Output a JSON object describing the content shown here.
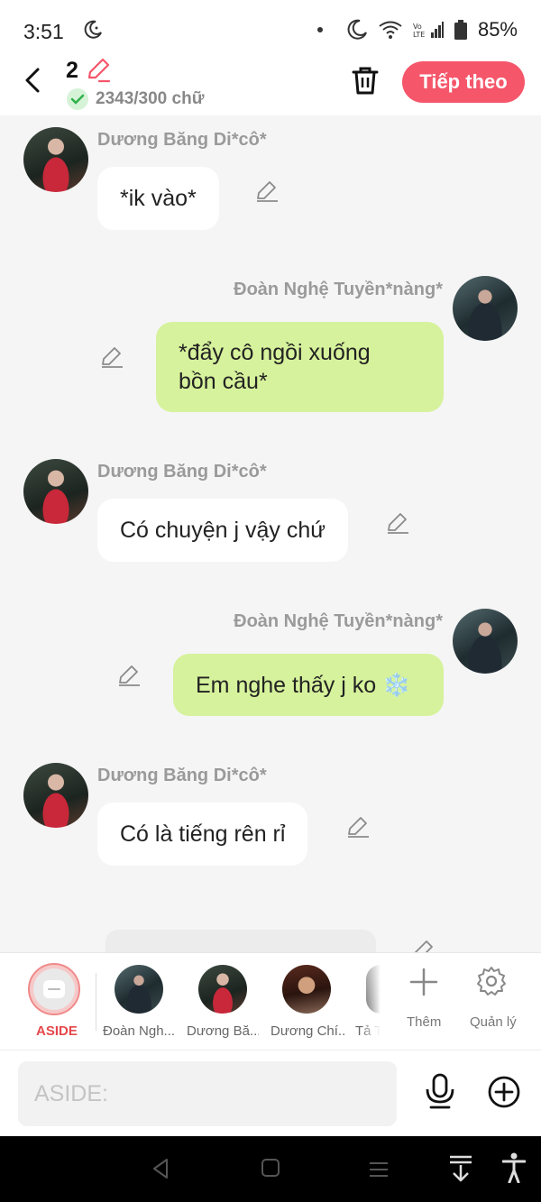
{
  "status_bar": {
    "time": "3:51",
    "battery": "85%"
  },
  "header": {
    "count": "2",
    "word_count": "2343/300 chữ",
    "next_label": "Tiếp theo"
  },
  "messages": [
    {
      "side": "in",
      "name": "Dương Băng Di*cô*",
      "text": "*ik vào*"
    },
    {
      "side": "out",
      "name": "Đoàn Nghệ Tuyền*nàng*",
      "line1": "*đẩy cô ngồi xuống",
      "line2": "bồn cầu*"
    },
    {
      "side": "in",
      "name": "Dương Băng Di*cô*",
      "text": "Có chuyện j vậy chứ"
    },
    {
      "side": "out",
      "name": "Đoàn Nghệ Tuyền*nàng*",
      "text": "Em nghe thấy j ko ❄️"
    },
    {
      "side": "in",
      "name": "Dương Băng Di*cô*",
      "text": "Có là tiếng rên rỉ"
    }
  ],
  "characters": {
    "aside_label": "ASIDE",
    "items": [
      {
        "label": "Đoàn Ngh..."
      },
      {
        "label": "Dương Bă..."
      },
      {
        "label": "Dương Chí..."
      },
      {
        "label": "Tả T"
      }
    ],
    "more_label": "Thêm",
    "manage_label": "Quản lý"
  },
  "input": {
    "placeholder": "ASIDE:"
  },
  "colors": {
    "accent": "#f5566a",
    "out_bubble": "#d6f29c",
    "in_bubble": "#ffffff",
    "background": "#f5f5f5"
  }
}
